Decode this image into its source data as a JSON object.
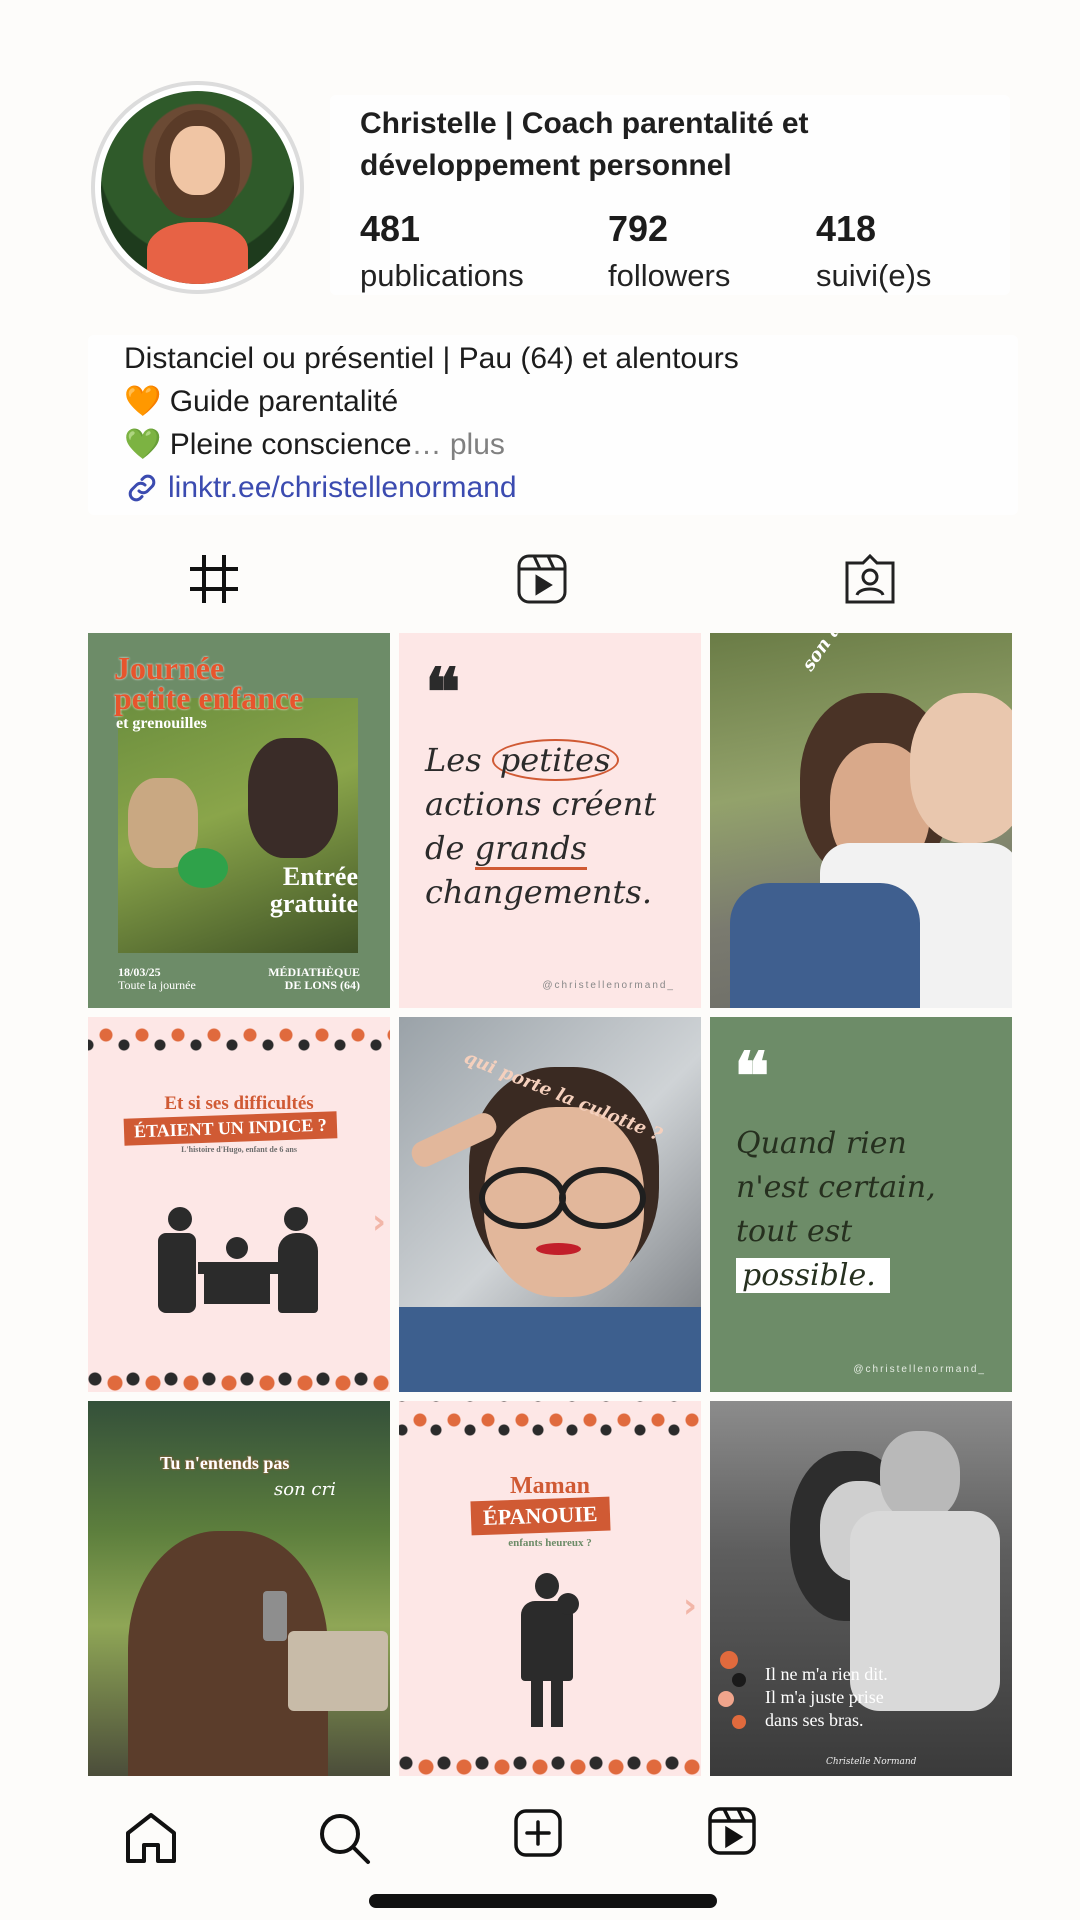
{
  "profile": {
    "name_line1": "Christelle | Coach parentalité et",
    "name_line2": "développement personnel",
    "avatar_icon": "profile-photo",
    "stats": [
      {
        "value": "481",
        "label": "publications"
      },
      {
        "value": "792",
        "label": "followers"
      },
      {
        "value": "418",
        "label": "suivi(e)s"
      }
    ]
  },
  "bio": {
    "line1": "Distanciel ou présentiel | Pau (64) et alentours",
    "line2_emoji": "🧡",
    "line2_text": "Guide parentalité",
    "line3_emoji": "💚",
    "line3_text": "Pleine conscience",
    "line3_ellipsis": "…",
    "more_label": "plus",
    "link_icon": "link-icon",
    "link_text": "linktr.ee/christellenormand"
  },
  "tabs": [
    "grid-icon",
    "reels-icon",
    "tagged-icon"
  ],
  "posts": {
    "p1": {
      "title1": "Journée",
      "title2": "petite enfance",
      "subtitle": "et grenouilles",
      "cta1": "Entrée",
      "cta2": "gratuite",
      "date": "18/03/25",
      "time": "Toute la journée",
      "place1": "MÉDIATHÈQUE",
      "place2": "DE LONS (64)"
    },
    "p2": {
      "quote_mark": "❝",
      "l1_a": "Les",
      "l1_b": "petites",
      "l2": "actions créent",
      "l3_a": "de",
      "l3_b": "grands",
      "l4": "changements.",
      "handle": "@christellenormand_"
    },
    "p3": {
      "caption": "son audace"
    },
    "p4": {
      "line1": "Et si ses difficultés",
      "line2": "ÉTAIENT UN INDICE ?",
      "line3": "L'histoire d'Hugo, enfant de 6 ans",
      "arrow": "›"
    },
    "p5": {
      "caption": "qui porte la culotte ?"
    },
    "p6": {
      "quote_mark": "❝",
      "l1": "Quand rien",
      "l2": "n'est certain,",
      "l3": "tout est",
      "l4": "possible.",
      "handle": "@christellenormand_"
    },
    "p7": {
      "line1": "Tu n'entends pas",
      "line2": "son cri"
    },
    "p8": {
      "line1": "Maman",
      "line2": "ÉPANOUIE",
      "line3": "enfants heureux ?",
      "arrow": "›"
    },
    "p9": {
      "l1": "Il ne m'a rien dit.",
      "l2": "Il m'a juste prise",
      "l3": "dans ses bras.",
      "signature": "Christelle Normand"
    }
  },
  "navbar": [
    "home-icon",
    "search-icon",
    "add-post-icon",
    "reels-icon"
  ],
  "colors": {
    "sage": "#6d8c68",
    "blush": "#fde7e6",
    "terracotta": "#d05a34",
    "dark": "#2b2b2b",
    "link": "#3b4bb0"
  }
}
